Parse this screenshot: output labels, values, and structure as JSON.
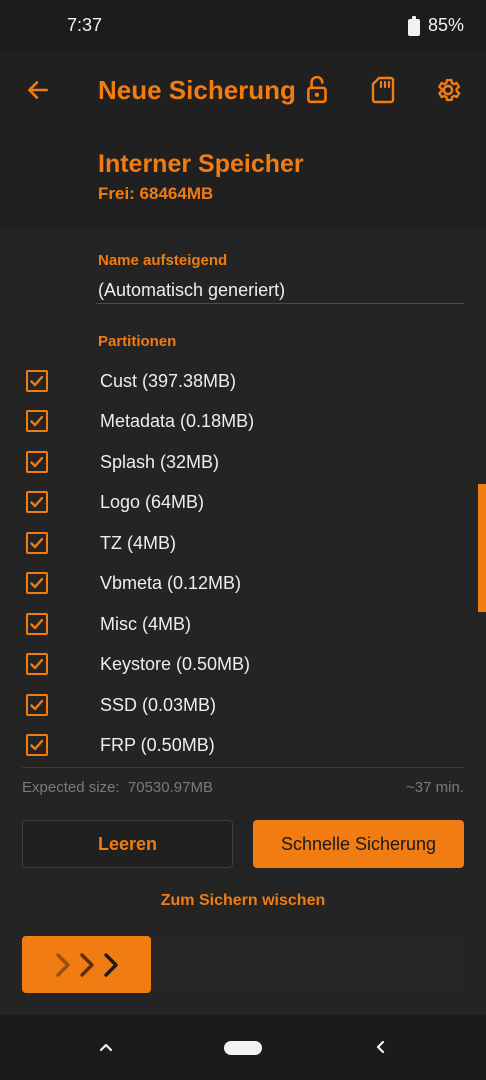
{
  "status_bar": {
    "time": "7:37",
    "battery": "85%",
    "battery_level": 0.85
  },
  "app_bar": {
    "title": "Neue Sicherung",
    "back_icon": "arrow-left-icon",
    "actions": [
      "lock-open-icon",
      "sd-card-icon",
      "gear-icon"
    ]
  },
  "storage": {
    "title": "Interner Speicher",
    "free": "Frei: 68464MB"
  },
  "name_section": {
    "label": "Name aufsteigend",
    "value": "(Automatisch generiert)"
  },
  "partitions": {
    "label": "Partitionen",
    "items": [
      {
        "name": "Cust (397.38MB)",
        "checked": true
      },
      {
        "name": "Metadata (0.18MB)",
        "checked": true
      },
      {
        "name": "Splash (32MB)",
        "checked": true
      },
      {
        "name": "Logo (64MB)",
        "checked": true
      },
      {
        "name": "TZ (4MB)",
        "checked": true
      },
      {
        "name": "Vbmeta (0.12MB)",
        "checked": true
      },
      {
        "name": "Misc (4MB)",
        "checked": true
      },
      {
        "name": "Keystore (0.50MB)",
        "checked": true
      },
      {
        "name": "SSD (0.03MB)",
        "checked": true
      },
      {
        "name": "FRP (0.50MB)",
        "checked": true
      }
    ]
  },
  "summary": {
    "expected": "Expected size:  70530.97MB",
    "duration": "~37 min."
  },
  "buttons": {
    "clear": "Leeren",
    "quick_backup": "Schnelle Sicherung"
  },
  "swipe": {
    "hint": "Zum Sichern wischen"
  },
  "colors": {
    "accent": "#f07c12",
    "background": "#202020",
    "text": "#eeeeee",
    "muted": "#7a7a7a"
  }
}
